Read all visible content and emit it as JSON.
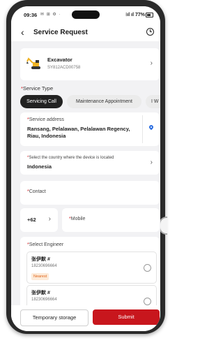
{
  "status_bar": {
    "time": "09:36",
    "icons": "✉ ⊞ ⚙ ·",
    "signal": "⁝ıl ıl",
    "battery": "77%"
  },
  "header": {
    "title": "Service Request",
    "back_icon": "chevron-left-icon",
    "history_icon": "clock-icon"
  },
  "device": {
    "name": "Excavator",
    "code": "SY812ACD00758",
    "icon": "excavator-icon"
  },
  "service_type": {
    "label": "Service Type",
    "options": [
      "Servicing Call",
      "Maintenance Appointment",
      "I W"
    ],
    "selected": "Servicing Call"
  },
  "service_address": {
    "label": "Service address",
    "value": "Ransang, Pelalawan, Pelalawan Regency, Riau, Indonesia"
  },
  "country": {
    "label": "Select the country where the device is located",
    "value": "Indonesia"
  },
  "contact": {
    "label": "Contact"
  },
  "phone": {
    "code": "+62",
    "mobile_label": "Mobile"
  },
  "engineer": {
    "label": "Select Engineer",
    "items": [
      {
        "name": "张伊默 #",
        "phone": "18230696664",
        "badge": "Nearest"
      },
      {
        "name": "张伊默 #",
        "phone": "18230696664",
        "badge": ""
      }
    ]
  },
  "actions": {
    "temporary": "Temporary storage",
    "submit": "Submit"
  },
  "colors": {
    "accent": "#c8161d",
    "required": "#d01f24",
    "pin": "#2a6de0",
    "nearest": "#e0641a"
  }
}
